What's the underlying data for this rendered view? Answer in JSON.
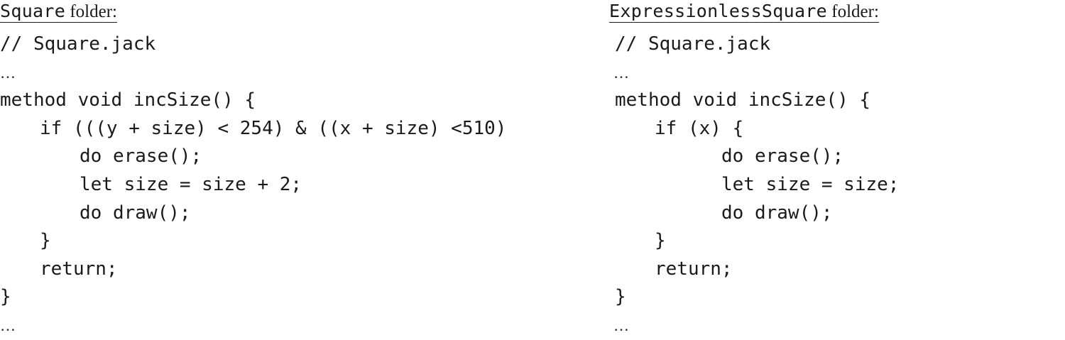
{
  "left": {
    "heading_name": "Square",
    "heading_suffix": " folder:",
    "lines": [
      {
        "text": "// Square.jack",
        "indent": 0,
        "kind": "code"
      },
      {
        "text": "…",
        "indent": 0,
        "kind": "ellipsis"
      },
      {
        "text": "method void incSize() {",
        "indent": 0,
        "kind": "code"
      },
      {
        "text": "if (((y + size) < 254) & ((x + size) <510)",
        "indent": 1,
        "kind": "code"
      },
      {
        "text": "do erase();",
        "indent": 2,
        "kind": "code"
      },
      {
        "text": "let size = size + 2;",
        "indent": 2,
        "kind": "code"
      },
      {
        "text": "do draw();",
        "indent": 2,
        "kind": "code"
      },
      {
        "text": "}",
        "indent": 1,
        "kind": "code"
      },
      {
        "text": "return;",
        "indent": 1,
        "kind": "code"
      },
      {
        "text": "}",
        "indent": 0,
        "kind": "code"
      },
      {
        "text": "…",
        "indent": 0,
        "kind": "ellipsis"
      }
    ]
  },
  "right": {
    "heading_name": "ExpressionlessSquare",
    "heading_suffix": " folder:",
    "lines": [
      {
        "text": "// Square.jack",
        "indent": 0,
        "kind": "code"
      },
      {
        "text": "…",
        "indent": 0,
        "kind": "ellipsis"
      },
      {
        "text": "method void incSize() {",
        "indent": 0,
        "kind": "code"
      },
      {
        "text": "if (x) {",
        "indent": 1,
        "kind": "code"
      },
      {
        "text": "do erase();",
        "indent": 2,
        "kind": "code"
      },
      {
        "text": "let size = size;",
        "indent": 2,
        "kind": "code"
      },
      {
        "text": "do draw();",
        "indent": 2,
        "kind": "code"
      },
      {
        "text": "}",
        "indent": 1,
        "kind": "code"
      },
      {
        "text": "return;",
        "indent": 1,
        "kind": "code"
      },
      {
        "text": "}",
        "indent": 0,
        "kind": "code"
      },
      {
        "text": "…",
        "indent": 0,
        "kind": "ellipsis"
      }
    ]
  }
}
